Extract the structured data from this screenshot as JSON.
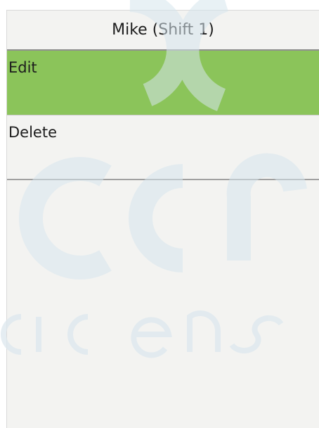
{
  "header": {
    "title": "Mike (Shift 1)"
  },
  "menu": {
    "items": [
      {
        "label": "Edit",
        "selected": true
      },
      {
        "label": "Delete",
        "selected": false
      }
    ]
  },
  "colors": {
    "background": "#f3f3f1",
    "selected": "#8bc45a",
    "text": "#1d1d1d",
    "divider": "#a0a0a0"
  }
}
